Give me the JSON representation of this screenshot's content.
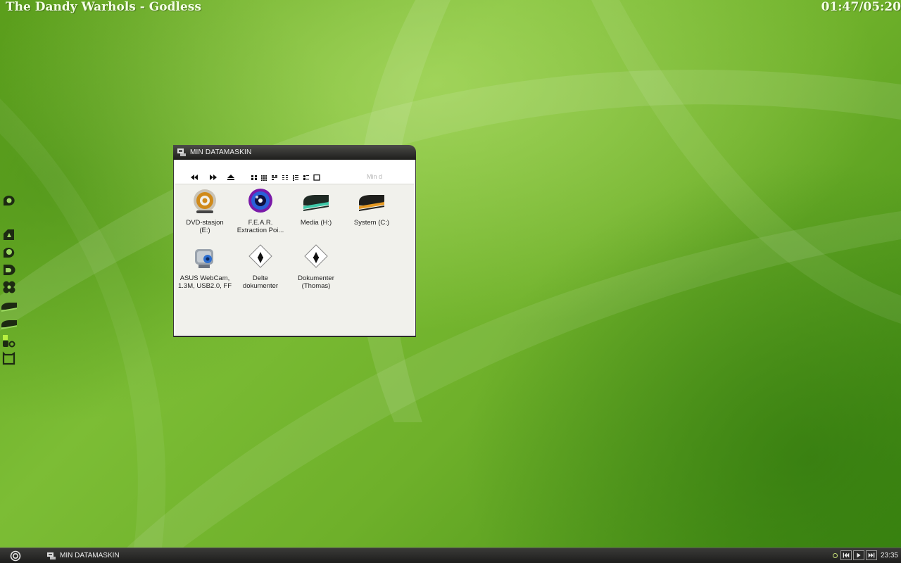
{
  "desktop": {
    "now_playing": "The Dandy Warhols - Godless",
    "track_time": "01:47/05:20",
    "dock_icons": [
      "disc-icon",
      "recycle-icon",
      "search-icon",
      "folder-icon",
      "clover-icon",
      "drive-icon",
      "drive-icon",
      "shapes-icon",
      "bag-icon"
    ]
  },
  "window": {
    "title": "MIN DATAMASKIN",
    "address": "Min d",
    "toolbar": [
      "back-icon",
      "forward-icon",
      "up-icon",
      "view-thumbnails-icon",
      "view-tiles-icon",
      "view-icons-icon",
      "view-list-icon",
      "view-details-icon",
      "view-filmstrip-icon",
      "view-single-icon"
    ],
    "items": [
      {
        "label1": "DVD-stasjon",
        "label2": "(E:)",
        "icon": "dvd-drive-icon"
      },
      {
        "label1": "F.E.A.R.",
        "label2": "Extraction Poi...",
        "icon": "fear-disc-icon"
      },
      {
        "label1": "Media (H:)",
        "label2": "",
        "icon": "hard-drive-teal-icon"
      },
      {
        "label1": "System (C:)",
        "label2": "",
        "icon": "hard-drive-orange-icon"
      },
      {
        "label1": "ASUS WebCam,",
        "label2": "1.3M, USB2.0, FF",
        "icon": "webcam-icon"
      },
      {
        "label1": "Delte",
        "label2": "dokumenter",
        "icon": "shared-documents-icon"
      },
      {
        "label1": "Dokumenter",
        "label2": "(Thomas)",
        "icon": "documents-icon"
      }
    ]
  },
  "taskbar": {
    "task_label": "MIN DATAMASKIN",
    "clock": "23:35"
  },
  "colors": {
    "wallpaper": "#6eb02a",
    "accent": "#c9e37a",
    "titlebar": "#2a2a28"
  }
}
